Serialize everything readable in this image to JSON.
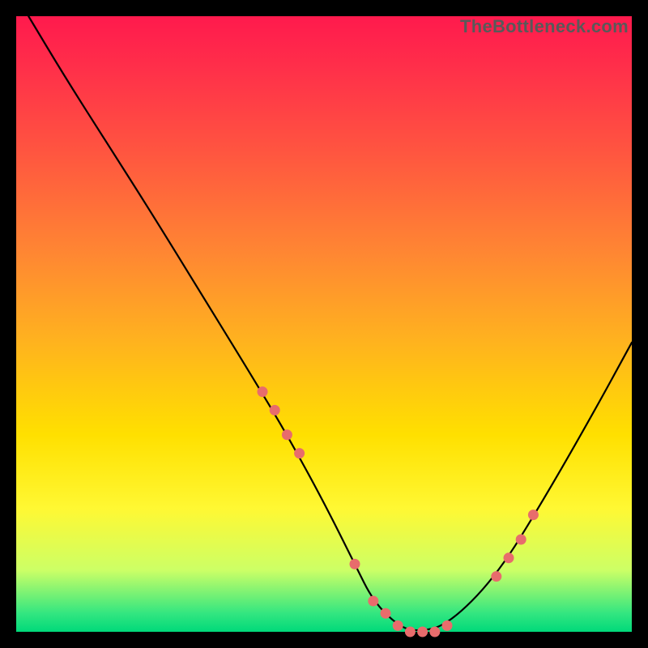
{
  "watermark": "TheBottleneck.com",
  "chart_data": {
    "type": "line",
    "title": "",
    "xlabel": "",
    "ylabel": "",
    "ylim": [
      0,
      100
    ],
    "xlim": [
      0,
      100
    ],
    "series": [
      {
        "name": "bottleneck-curve",
        "x": [
          2,
          8,
          15,
          22,
          30,
          38,
          44,
          50,
          55,
          58,
          62,
          65,
          70,
          78,
          86,
          94,
          100
        ],
        "y": [
          100,
          90,
          79,
          68,
          55,
          42,
          32,
          21,
          11,
          5,
          1,
          0,
          1,
          9,
          22,
          36,
          47
        ]
      }
    ],
    "markers": {
      "name": "highlight-points",
      "color": "#e86c6c",
      "x": [
        40,
        42,
        44,
        46,
        55,
        58,
        60,
        62,
        64,
        66,
        68,
        70,
        78,
        80,
        82,
        84
      ],
      "y": [
        39,
        36,
        32,
        29,
        11,
        5,
        3,
        1,
        0,
        0,
        0,
        1,
        9,
        12,
        15,
        19
      ]
    },
    "gradient_stops": [
      {
        "offset": 0,
        "color": "#ff1a4d"
      },
      {
        "offset": 22,
        "color": "#ff5540"
      },
      {
        "offset": 52,
        "color": "#ffb020"
      },
      {
        "offset": 80,
        "color": "#fff833"
      },
      {
        "offset": 100,
        "color": "#00d97a"
      }
    ]
  }
}
